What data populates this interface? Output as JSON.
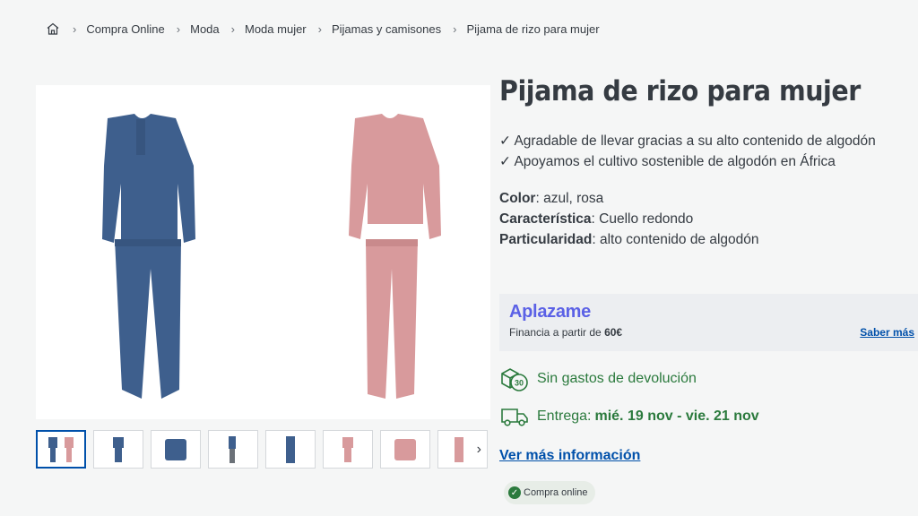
{
  "breadcrumb": {
    "items": [
      "Compra Online",
      "Moda",
      "Moda mujer",
      "Pijamas y camisones",
      "Pijama de rizo para mujer"
    ]
  },
  "product": {
    "title": "Pijama de rizo para mujer",
    "features": [
      "✓ Agradable de llevar gracias a su alto contenido de algodón",
      "✓ Apoyamos el cultivo sostenible de algodón en África"
    ],
    "attributes": [
      {
        "label": "Color",
        "value": ": azul, rosa"
      },
      {
        "label": "Característica",
        "value": ": Cuello redondo"
      },
      {
        "label": "Particularidad",
        "value": ": alto contenido de algodón"
      }
    ],
    "colors": {
      "blue": "#3e5f8d",
      "pink": "#d89a9c"
    }
  },
  "aplazame": {
    "logo": "Aplazame",
    "financing_prefix": "Financia a partir de ",
    "financing_amount": "60€",
    "more_label": "Saber más"
  },
  "returns": {
    "label": "Sin gastos de devolución",
    "icon_days": "30"
  },
  "delivery": {
    "prefix": "Entrega: ",
    "dates": "mié. 19 nov - vie. 21 nov"
  },
  "more_info_label": "Ver más información",
  "badge_label": "Compra online",
  "gallery": {
    "next_arrow": "›"
  },
  "theme": {
    "green": "#2b7a3d",
    "link_blue": "#0050aa",
    "aplazame_purple": "#5b61e6"
  }
}
